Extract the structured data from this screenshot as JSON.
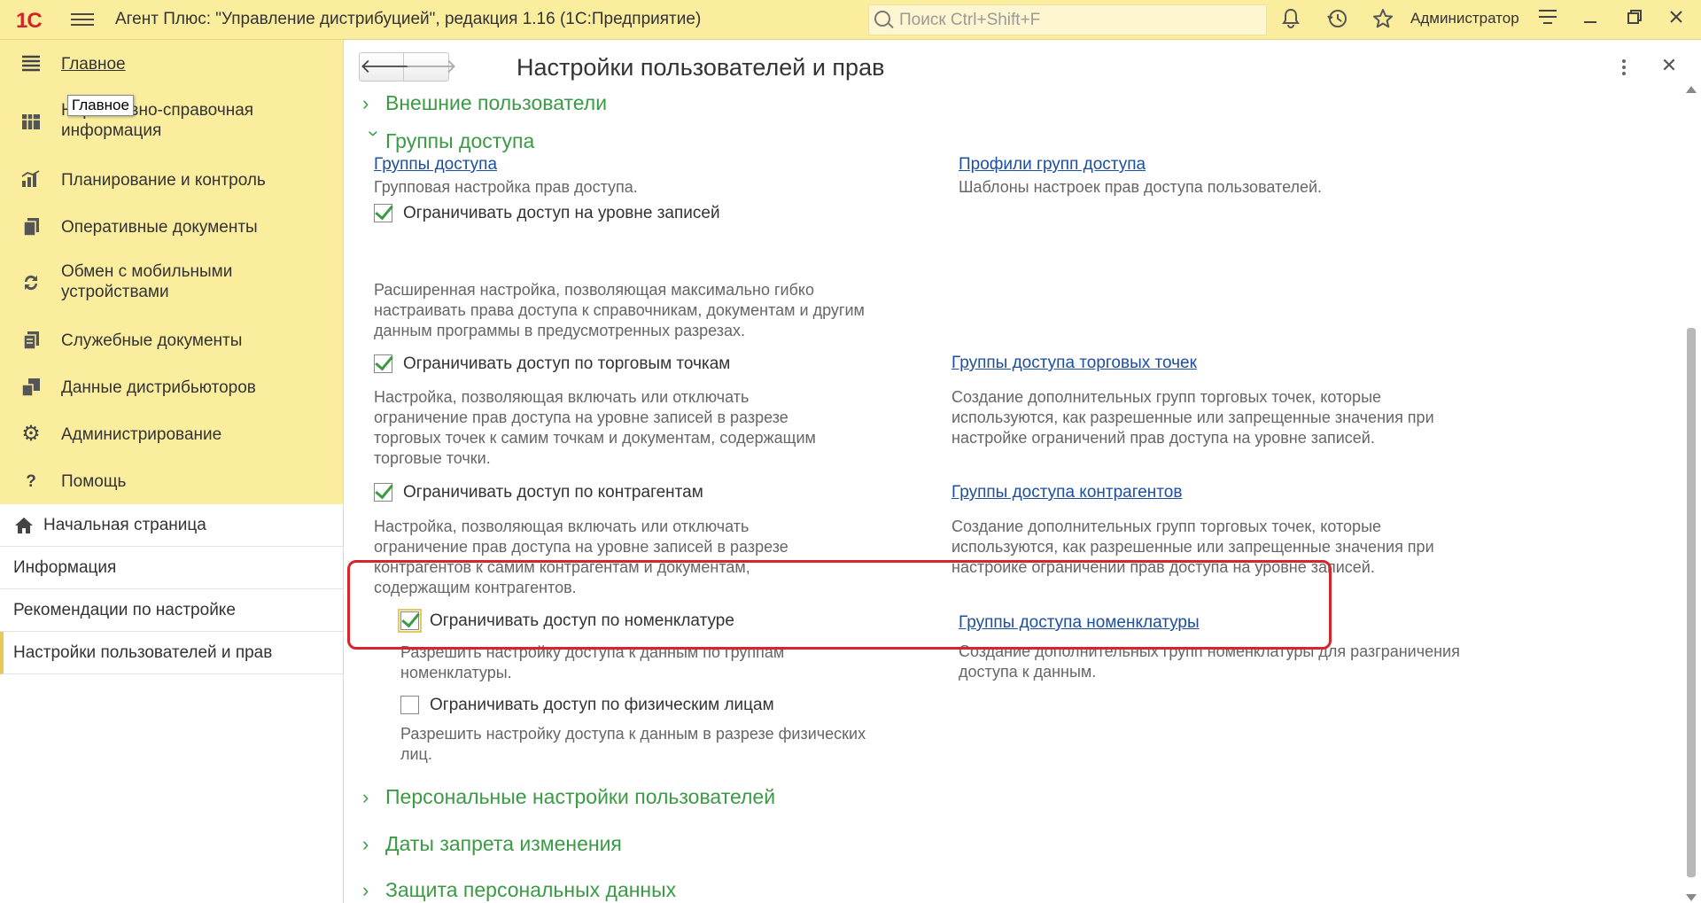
{
  "titlebar": {
    "logo": "1С",
    "title": "Агент Плюс: \"Управление дистрибуцией\", редакция 1.16  (1С:Предприятие)",
    "search_placeholder": "Поиск Ctrl+Shift+F",
    "user": "Администратор"
  },
  "sidebar": {
    "tooltip": "Главное",
    "sections": [
      {
        "label": "Главное",
        "icon": "menu-icon"
      },
      {
        "label": "Нормативно-справочная информация",
        "icon": "reference-icon"
      },
      {
        "label": "Планирование и контроль",
        "icon": "chart-icon"
      },
      {
        "label": "Оперативные документы",
        "icon": "documents-icon"
      },
      {
        "label": "Обмен с мобильными устройствами",
        "icon": "sync-icon"
      },
      {
        "label": "Служебные документы",
        "icon": "service-docs-icon"
      },
      {
        "label": "Данные дистрибьюторов",
        "icon": "distributors-icon"
      },
      {
        "label": "Администрирование",
        "icon": "gear-icon"
      },
      {
        "label": "Помощь",
        "icon": "help-icon"
      }
    ],
    "nav": [
      {
        "label": "Начальная страница"
      },
      {
        "label": "Информация"
      },
      {
        "label": "Рекомендации по настройке"
      },
      {
        "label": "Настройки пользователей и прав"
      }
    ]
  },
  "form": {
    "title": "Настройки пользователей и прав",
    "groups": {
      "external_users": "Внешние пользователи",
      "access_groups": "Группы доступа",
      "personal_settings": "Персональные настройки пользователей",
      "change_lock_dates": "Даты запрета изменения",
      "personal_data_protection": "Защита персональных данных"
    },
    "access_groups_link": "Группы доступа",
    "access_groups_desc": "Групповая настройка прав доступа.",
    "profiles_link": "Профили групп доступа",
    "profiles_desc": "Шаблоны настроек прав доступа пользователей.",
    "options": [
      {
        "label": "Ограничивать доступ на уровне записей",
        "checked": true,
        "desc_lines": [
          "Расширенная настройка, позволяющая максимально гибко",
          "настраивать права доступа к справочникам, документам и другим",
          "данным программы в предусмотренных разрезах."
        ]
      },
      {
        "label": "Ограничивать доступ по торговым точкам",
        "checked": true,
        "desc_lines": [
          "Настройка, позволяющая включать или отключать",
          "ограничение прав доступа на уровне записей в разрезе",
          "торговых точек к самим точкам и документам, содержащим",
          "торговые точки."
        ],
        "link": "Группы доступа торговых точек",
        "link_desc_lines": [
          "Создание дополнительных групп торговых точек, которые",
          "используются, как разрешенные или запрещенные значения при",
          "настройке ограничений прав доступа на уровне записей."
        ]
      },
      {
        "label": "Ограничивать доступ по контрагентам",
        "checked": true,
        "desc_lines": [
          "Настройка, позволяющая включать или отключать",
          "ограничение прав доступа на уровне записей в разрезе",
          "контрагентов к самим контрагентам и документам,",
          "содержащим контрагентов."
        ],
        "link": "Группы доступа контрагентов",
        "link_desc_lines": [
          "Создание дополнительных групп торговых точек, которые",
          "используются, как разрешенные или запрещенные значения при",
          "настройке ограничений прав доступа на уровне записей."
        ]
      },
      {
        "label": "Ограничивать доступ по номенклатуре",
        "checked": true,
        "desc_lines": [
          "Разрешить настройку доступа к данным по группам",
          "номенклатуры."
        ],
        "link": "Группы доступа номенклатуры",
        "link_desc_lines": [
          "Создание дополнительных групп номенклатуры для разграничения",
          "доступа к данным."
        ]
      },
      {
        "label": "Ограничивать доступ по физическим лицам",
        "checked": false,
        "desc_lines": [
          "Разрешить настройку доступа к данным в разрезе физических",
          "лиц."
        ]
      }
    ]
  },
  "colors": {
    "titlebar_bg": "#fbed9e",
    "group_green": "#3b9b45",
    "link_blue": "#1c4fa0",
    "highlight_red": "#d9232d"
  }
}
